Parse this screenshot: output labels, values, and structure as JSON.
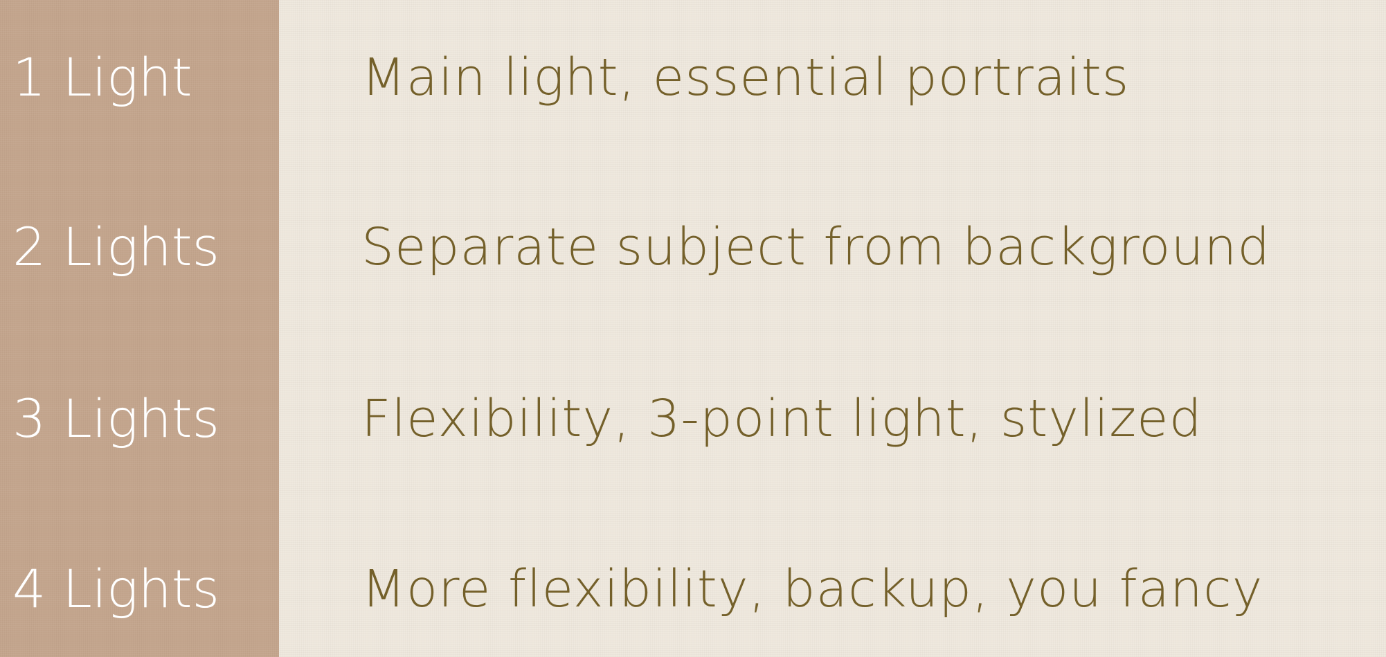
{
  "colors": {
    "sidebar": "#c3a58d",
    "background": "#efe9df",
    "label_text": "#ffffff",
    "description_text": "#74602a"
  },
  "rows": [
    {
      "label": "1 Light",
      "description": "Main light, essential portraits"
    },
    {
      "label": "2 Lights",
      "description": "Separate subject from background"
    },
    {
      "label": "3 Lights",
      "description": "Flexibility, 3-point light, stylized"
    },
    {
      "label": "4 Lights",
      "description": "More flexibility, backup, you fancy"
    }
  ]
}
